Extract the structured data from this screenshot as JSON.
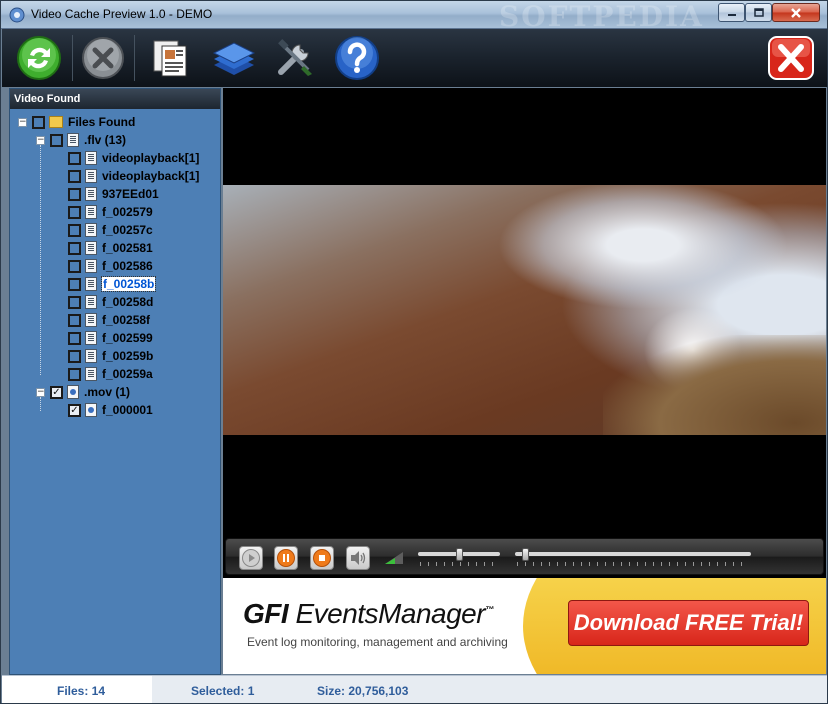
{
  "window": {
    "title": "Video Cache Preview 1.0 - DEMO",
    "watermark": "SOFTPEDIA",
    "accent_title": "#a9c1da"
  },
  "toolbar": {
    "items": [
      {
        "name": "refresh",
        "icon": "refresh-icon"
      },
      {
        "name": "stop",
        "icon": "stop-cancel-icon"
      },
      {
        "name": "report",
        "icon": "documents-icon"
      },
      {
        "name": "pages",
        "icon": "stacked-pages-icon"
      },
      {
        "name": "settings",
        "icon": "tools-icon"
      },
      {
        "name": "help",
        "icon": "help-icon"
      },
      {
        "name": "exit",
        "icon": "exit-icon"
      }
    ]
  },
  "panel": {
    "header": "Video Found",
    "root": "Files Found",
    "groups": [
      {
        "label": ".flv (13)",
        "checked": false,
        "files": [
          {
            "label": "videoplayback[1]",
            "checked": false
          },
          {
            "label": "videoplayback[1]",
            "checked": false
          },
          {
            "label": "937EEd01",
            "checked": false
          },
          {
            "label": "f_002579",
            "checked": false
          },
          {
            "label": "f_00257c",
            "checked": false
          },
          {
            "label": "f_002581",
            "checked": false
          },
          {
            "label": "f_002586",
            "checked": false
          },
          {
            "label": "f_00258b",
            "checked": false,
            "selected": true
          },
          {
            "label": "f_00258d",
            "checked": false
          },
          {
            "label": "f_00258f",
            "checked": false
          },
          {
            "label": "f_002599",
            "checked": false
          },
          {
            "label": "f_00259b",
            "checked": false
          },
          {
            "label": "f_00259a",
            "checked": false
          }
        ]
      },
      {
        "label": ".mov (1)",
        "checked": true,
        "files": [
          {
            "label": "f_000001",
            "checked": true
          }
        ]
      }
    ]
  },
  "player": {
    "volume_level": 0.5,
    "position_level": 0.03
  },
  "ad": {
    "brand_bold": "GFI ",
    "brand_thin": "EventsManager",
    "trademark": "™",
    "tagline": "Event log monitoring, management and archiving",
    "cta": "Download FREE Trial!"
  },
  "status": {
    "files": "Files: 14",
    "selected": "Selected: 1",
    "size": "Size: 20,756,103"
  }
}
